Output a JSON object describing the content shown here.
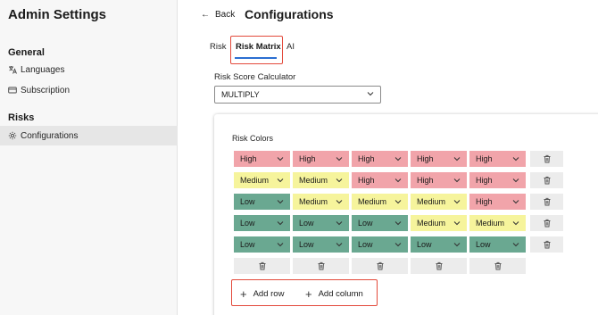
{
  "sidebar": {
    "title": "Admin Settings",
    "sections": [
      {
        "title": "General",
        "items": [
          {
            "label": "Languages",
            "icon": "translate-icon"
          },
          {
            "label": "Subscription",
            "icon": "card-icon"
          }
        ]
      },
      {
        "title": "Risks",
        "items": [
          {
            "label": "Configurations",
            "icon": "gear-icon",
            "active": true
          }
        ]
      }
    ]
  },
  "header": {
    "back_label": "Back",
    "title": "Configurations"
  },
  "tabs": [
    {
      "label": "Risk"
    },
    {
      "label": "Risk Matrix",
      "selected": true
    },
    {
      "label": "AI"
    }
  ],
  "calculator": {
    "label": "Risk Score Calculator",
    "value": "MULTIPLY"
  },
  "risk_colors": {
    "label": "Risk Colors",
    "rows": [
      [
        "High",
        "High",
        "High",
        "High",
        "High"
      ],
      [
        "Medium",
        "Medium",
        "High",
        "High",
        "High"
      ],
      [
        "Low",
        "Medium",
        "Medium",
        "Medium",
        "High"
      ],
      [
        "Low",
        "Low",
        "Low",
        "Medium",
        "Medium"
      ],
      [
        "Low",
        "Low",
        "Low",
        "Low",
        "Low"
      ]
    ]
  },
  "actions": {
    "add_row": "Add row",
    "add_column": "Add column"
  },
  "colors": {
    "high": "#f1a4aa",
    "medium": "#f6f49c",
    "low": "#6aa891",
    "accent": "#2b6fd1",
    "highlight": "#e34a3b"
  }
}
